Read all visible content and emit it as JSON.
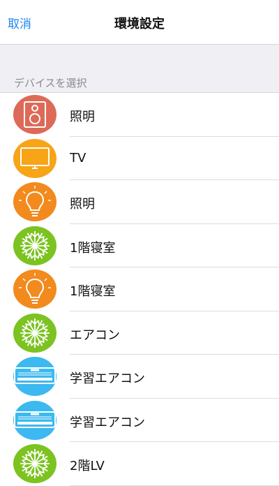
{
  "nav": {
    "cancel_label": "取消",
    "title": "環境設定"
  },
  "section": {
    "header": "デバイスを選択"
  },
  "colors": {
    "red": "#dd6a58",
    "orange": "#f28a1e",
    "amber": "#f7a417",
    "green": "#7cc321",
    "cyan": "#3bb9f0",
    "accent": "#1e86f1"
  },
  "devices": [
    {
      "label": "照明",
      "icon": "speaker-icon",
      "color": "#dd6a58"
    },
    {
      "label": "TV",
      "icon": "tv-icon",
      "color": "#f7a417"
    },
    {
      "label": "照明",
      "icon": "lightbulb-icon",
      "color": "#f28a1e"
    },
    {
      "label": "1階寝室",
      "icon": "snowflake-icon",
      "color": "#7cc321"
    },
    {
      "label": "1階寝室",
      "icon": "lightbulb-icon",
      "color": "#f28a1e"
    },
    {
      "label": "エアコン",
      "icon": "snowflake-icon",
      "color": "#7cc321"
    },
    {
      "label": "学習エアコン",
      "icon": "air-conditioner-icon",
      "color": "#3bb9f0"
    },
    {
      "label": "学習エアコン",
      "icon": "air-conditioner-icon",
      "color": "#3bb9f0"
    },
    {
      "label": "2階LV",
      "icon": "snowflake-icon",
      "color": "#7cc321"
    }
  ]
}
